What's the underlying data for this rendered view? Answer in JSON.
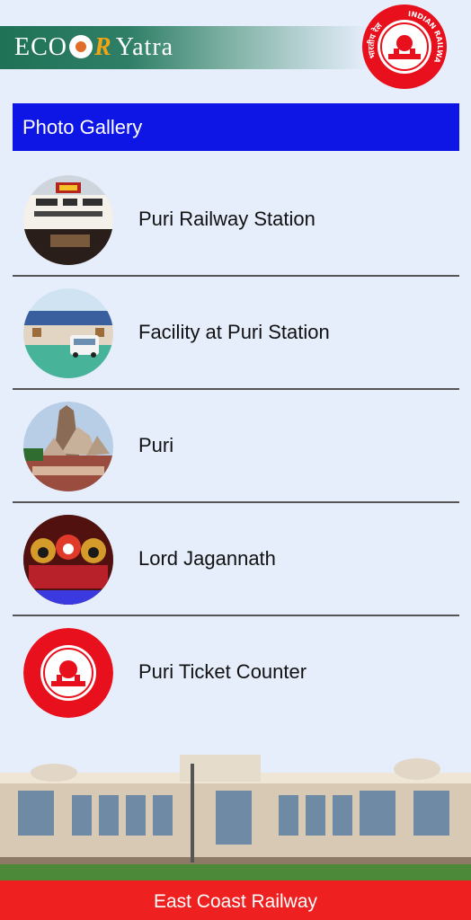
{
  "header": {
    "brand_prefix": "ECO",
    "brand_r": "R",
    "brand_suffix": "Yatra",
    "logo_icon": "indian-railways-logo",
    "logo_text_left": "भारतीय रेल",
    "logo_text_right": "INDIAN RAILWAYS"
  },
  "page": {
    "title": "Photo Gallery"
  },
  "gallery": {
    "items": [
      {
        "label": "Puri Railway Station",
        "thumb": "puri-station-signboard-photo"
      },
      {
        "label": "Facility at Puri Station",
        "thumb": "station-facility-photo"
      },
      {
        "label": "Puri",
        "thumb": "puri-temple-photo"
      },
      {
        "label": "Lord Jagannath",
        "thumb": "lord-jagannath-photo"
      },
      {
        "label": "Puri Ticket Counter",
        "thumb": "indian-railways-logo"
      }
    ]
  },
  "footer": {
    "label": "East Coast Railway",
    "color": "#ee2020"
  },
  "colors": {
    "title_bar": "#0e16e6",
    "background": "#e6eefc",
    "brand_green": "#1f7256",
    "brand_orange": "#f1a514"
  }
}
